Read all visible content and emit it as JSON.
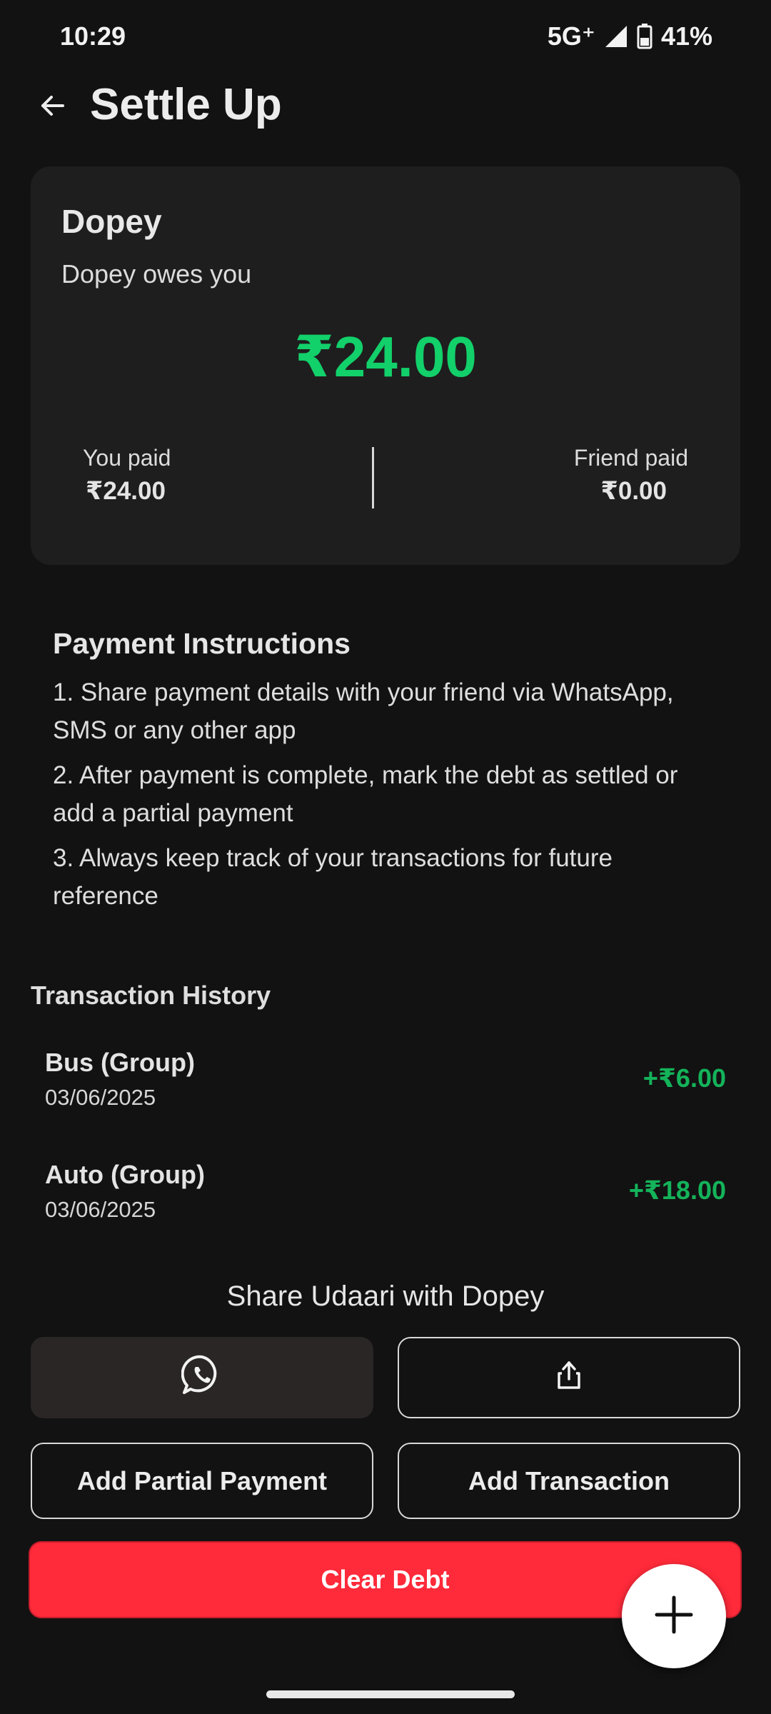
{
  "status_bar": {
    "time": "10:29",
    "network": "5G⁺",
    "battery_percent": "41%",
    "battery_level": 0.41
  },
  "app_bar": {
    "title": "Settle Up",
    "back_icon": "arrow-left-icon"
  },
  "summary": {
    "friend_name": "Dopey",
    "status_text": "Dopey owes you",
    "balance": "₹24.00",
    "you_paid_label": "You paid",
    "you_paid_value": "₹24.00",
    "friend_paid_label": "Friend paid",
    "friend_paid_value": "₹0.00"
  },
  "instructions": {
    "title": "Payment Instructions",
    "items": [
      "1. Share payment details with your friend via WhatsApp, SMS or any other app",
      "2. After payment is complete, mark the debt as settled or add a partial payment",
      "3. Always keep track of your transactions for future reference"
    ]
  },
  "history": {
    "title": "Transaction History",
    "transactions": [
      {
        "name": "Bus (Group)",
        "date": "03/06/2025",
        "amount": "+₹6.00"
      },
      {
        "name": "Auto (Group)",
        "date": "03/06/2025",
        "amount": "+₹18.00"
      }
    ]
  },
  "share": {
    "title": "Share Udaari with Dopey",
    "whatsapp_icon": "whatsapp-icon",
    "share_icon": "share-icon"
  },
  "actions": {
    "partial_payment_label": "Add Partial Payment",
    "add_transaction_label": "Add Transaction",
    "clear_debt_label": "Clear Debt",
    "fab_icon": "plus-icon"
  },
  "colors": {
    "background": "#121212",
    "card": "#1e1e1e",
    "accent_green": "#12d06a",
    "danger_red": "#ff2a3a"
  }
}
